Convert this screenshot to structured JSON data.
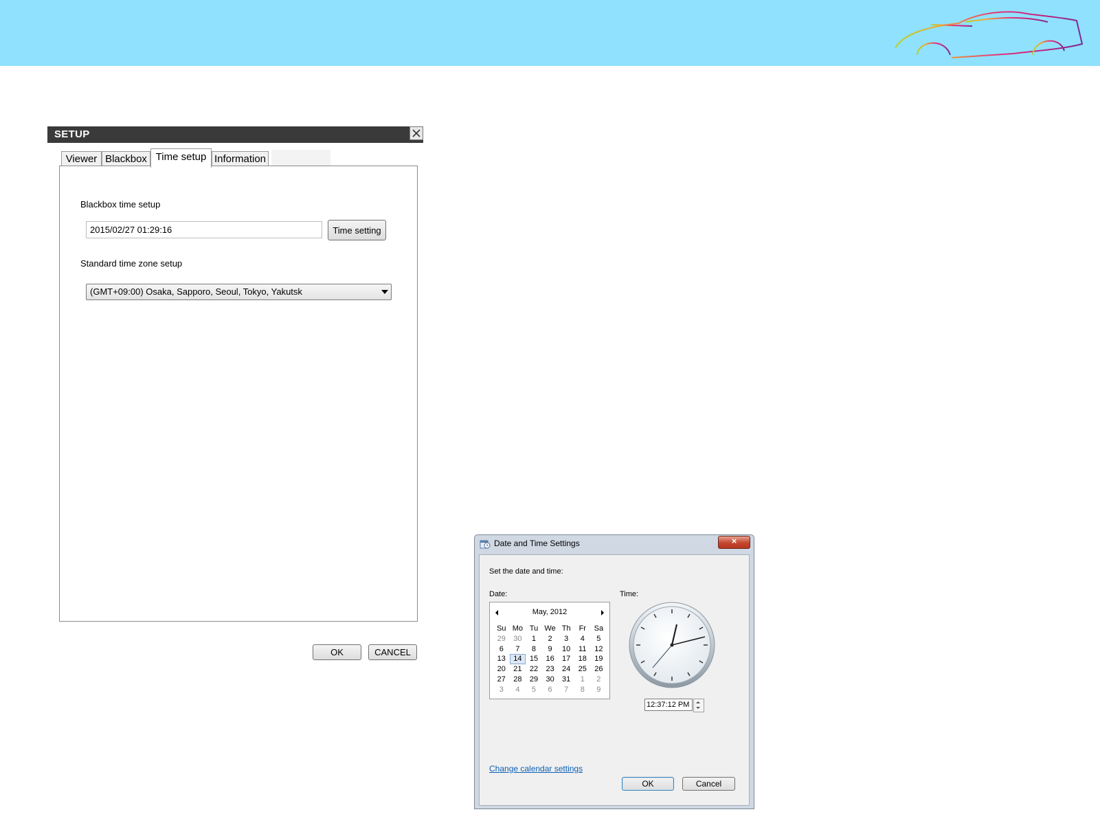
{
  "setup_dialog": {
    "title": "SETUP",
    "tabs": [
      {
        "label": "Viewer"
      },
      {
        "label": "Blackbox"
      },
      {
        "label": "Time setup"
      },
      {
        "label": "Information"
      }
    ],
    "active_tab": "Time setup",
    "blackbox_time": {
      "label": "Blackbox time setup",
      "value": "2015/02/27 01:29:16",
      "button_label": "Time setting"
    },
    "timezone": {
      "label": "Standard time zone setup",
      "selected": "(GMT+09:00) Osaka, Sapporo, Seoul, Tokyo, Yakutsk"
    },
    "ok_label": "OK",
    "cancel_label": "CANCEL"
  },
  "datetime_dialog": {
    "title": "Date and Time Settings",
    "instruction": "Set the date and time:",
    "date_label": "Date:",
    "time_label": "Time:",
    "calendar": {
      "month_year": "May, 2012",
      "weekdays": [
        "Su",
        "Mo",
        "Tu",
        "We",
        "Th",
        "Fr",
        "Sa"
      ],
      "weeks": [
        [
          "29",
          "30",
          "1",
          "2",
          "3",
          "4",
          "5"
        ],
        [
          "6",
          "7",
          "8",
          "9",
          "10",
          "11",
          "12"
        ],
        [
          "13",
          "14",
          "15",
          "16",
          "17",
          "18",
          "19"
        ],
        [
          "20",
          "21",
          "22",
          "23",
          "24",
          "25",
          "26"
        ],
        [
          "27",
          "28",
          "29",
          "30",
          "31",
          "1",
          "2"
        ],
        [
          "3",
          "4",
          "5",
          "6",
          "7",
          "8",
          "9"
        ]
      ],
      "selected_day": "14"
    },
    "time_value": "12:37:12 PM",
    "link_label": "Change calendar settings",
    "ok_label": "OK",
    "cancel_label": "Cancel"
  },
  "colors": {
    "banner": "#8fe1fd",
    "title_bar": "#3a3a3a",
    "link": "#0b5fb4"
  }
}
